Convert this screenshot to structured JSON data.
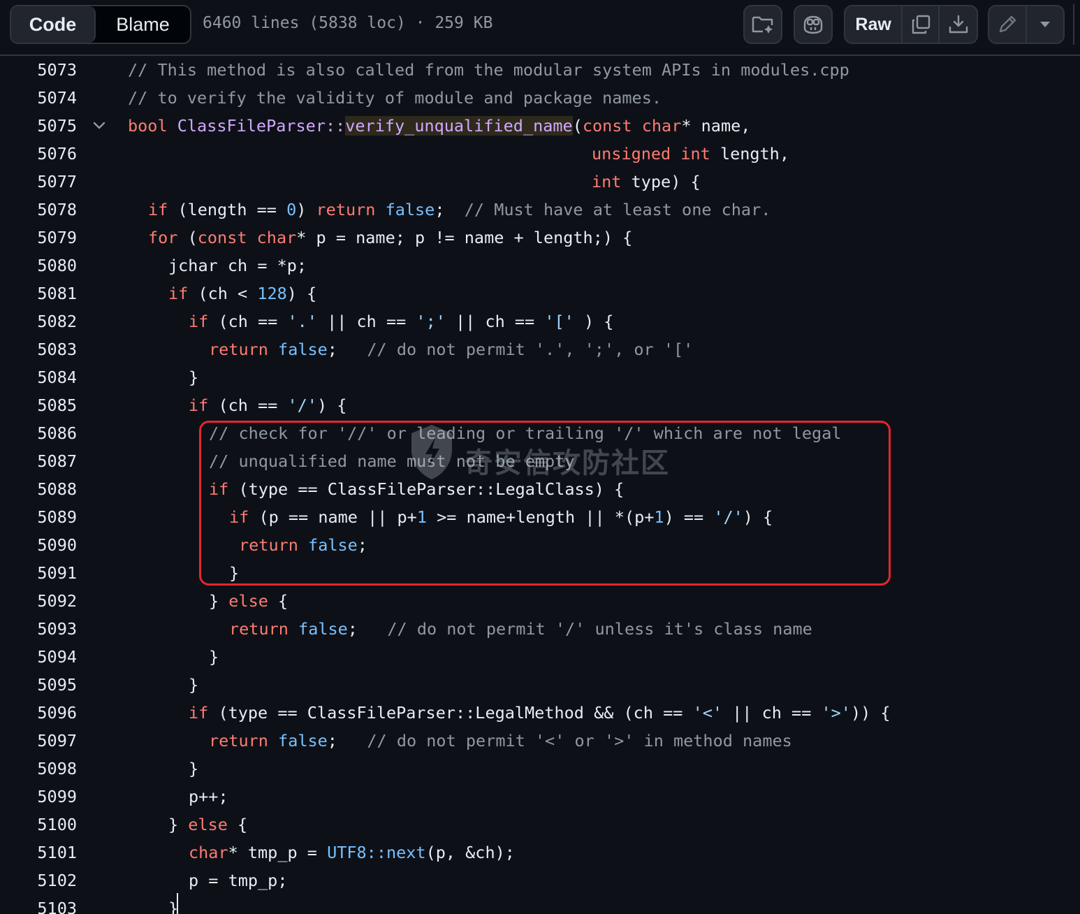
{
  "toolbar": {
    "code_tab": "Code",
    "blame_tab": "Blame",
    "file_info": "6460 lines (5838 loc) · 259 KB",
    "raw_label": "Raw",
    "icons": [
      "folder-sparkle-icon",
      "copilot-icon",
      "copy-icon",
      "download-icon",
      "pencil-icon",
      "chevron-down-icon"
    ]
  },
  "code": {
    "lines": [
      {
        "n": "5073"
      },
      {
        "n": "5074"
      },
      {
        "n": "5075"
      },
      {
        "n": "5076"
      },
      {
        "n": "5077"
      },
      {
        "n": "5078"
      },
      {
        "n": "5079"
      },
      {
        "n": "5080"
      },
      {
        "n": "5081"
      },
      {
        "n": "5082"
      },
      {
        "n": "5083"
      },
      {
        "n": "5084"
      },
      {
        "n": "5085"
      },
      {
        "n": "5086"
      },
      {
        "n": "5087"
      },
      {
        "n": "5088"
      },
      {
        "n": "5089"
      },
      {
        "n": "5090"
      },
      {
        "n": "5091"
      },
      {
        "n": "5092"
      },
      {
        "n": "5093"
      },
      {
        "n": "5094"
      },
      {
        "n": "5095"
      },
      {
        "n": "5096"
      },
      {
        "n": "5097"
      },
      {
        "n": "5098"
      },
      {
        "n": "5099"
      },
      {
        "n": "5100"
      },
      {
        "n": "5101"
      },
      {
        "n": "5102"
      },
      {
        "n": "5103"
      }
    ],
    "tokens": {
      "l5073": "// This method is also called from the modular system APIs in modules.cpp",
      "l5074": "// to verify the validity of module and package names.",
      "l5075_bool": "bool",
      "l5075_cls": "ClassFileParser::",
      "l5075_fn": "verify_unqualified_name",
      "l5075_paren": "(",
      "l5075_const": "const",
      "l5075_char": "char",
      "l5075_rest": "* name,",
      "l5076_unsigned": "unsigned",
      "l5076_int": "int",
      "l5076_rest": " length,",
      "l5077_int": "int",
      "l5077_rest": " type) {",
      "l5078_if": "if",
      "l5078_a": " (length == ",
      "l5078_zero": "0",
      "l5078_b": ") ",
      "l5078_return": "return",
      "l5078_false": "false",
      "l5078_c": ";  ",
      "l5078_cm": "// Must have at least one char.",
      "l5079_for": "for",
      "l5079_a": " (",
      "l5079_const": "const",
      "l5079_char": "char",
      "l5079_b": "* p = name; p != name + length;) {",
      "l5080": "jchar ch = *p;",
      "l5081_if": "if",
      "l5081_a": " (ch < ",
      "l5081_num": "128",
      "l5081_b": ") {",
      "l5082_if": "if",
      "l5082_a": " (ch == ",
      "l5082_s1": "'.'",
      "l5082_b": " || ch == ",
      "l5082_s2": "';'",
      "l5082_c": " || ch == ",
      "l5082_s3": "'['",
      "l5082_d": " ) {",
      "l5083_return": "return",
      "l5083_false": "false",
      "l5083_a": ";   ",
      "l5083_cm": "// do not permit '.', ';', or '['",
      "brace_close": "}",
      "l5085_if": "if",
      "l5085_a": " (ch == ",
      "l5085_s": "'/'",
      "l5085_b": ") {",
      "l5086": "// check for '//' or leading or trailing '/' which are not legal",
      "l5087": "// unqualified name must not be empty",
      "l5088_if": "if",
      "l5088_a": " (type == ClassFileParser::LegalClass) {",
      "l5089_if": "if",
      "l5089_a": " (p == name || p+",
      "l5089_one": "1",
      "l5089_b": " >= name+length || *(p+",
      "l5089_one2": "1",
      "l5089_c": ") == ",
      "l5089_s": "'/'",
      "l5089_d": ") {",
      "l5090_return": "return",
      "l5090_false": "false",
      "l5090_a": ";",
      "l5092_a": "} ",
      "l5092_else": "else",
      "l5092_b": " {",
      "l5093_return": "return",
      "l5093_false": "false",
      "l5093_a": ";   ",
      "l5093_cm": "// do not permit '/' unless it's class name",
      "l5096_if": "if",
      "l5096_a": " (type == ClassFileParser::LegalMethod && (ch == ",
      "l5096_s1": "'<'",
      "l5096_b": " || ch == ",
      "l5096_s2": "'>'",
      "l5096_c": ")) {",
      "l5097_return": "return",
      "l5097_false": "false",
      "l5097_a": ";   ",
      "l5097_cm": "// do not permit '<' or '>' in method names",
      "l5099": "p++;",
      "l5100_a": "} ",
      "l5100_else": "else",
      "l5100_b": " {",
      "l5101_char": "char",
      "l5101_a": "* tmp_p = ",
      "l5101_utf": "UTF8::next",
      "l5101_b": "(p, &ch);",
      "l5102": "p = tmp_p;"
    }
  },
  "watermark": {
    "text": "奇安信攻防社区"
  },
  "colors": {
    "background": "#0d1117",
    "keyword": "#ff7b72",
    "function": "#d2a8ff",
    "comment": "#9198a1",
    "number": "#79c0ff",
    "string": "#a5d6ff",
    "highlight_box": "#e5262e"
  }
}
